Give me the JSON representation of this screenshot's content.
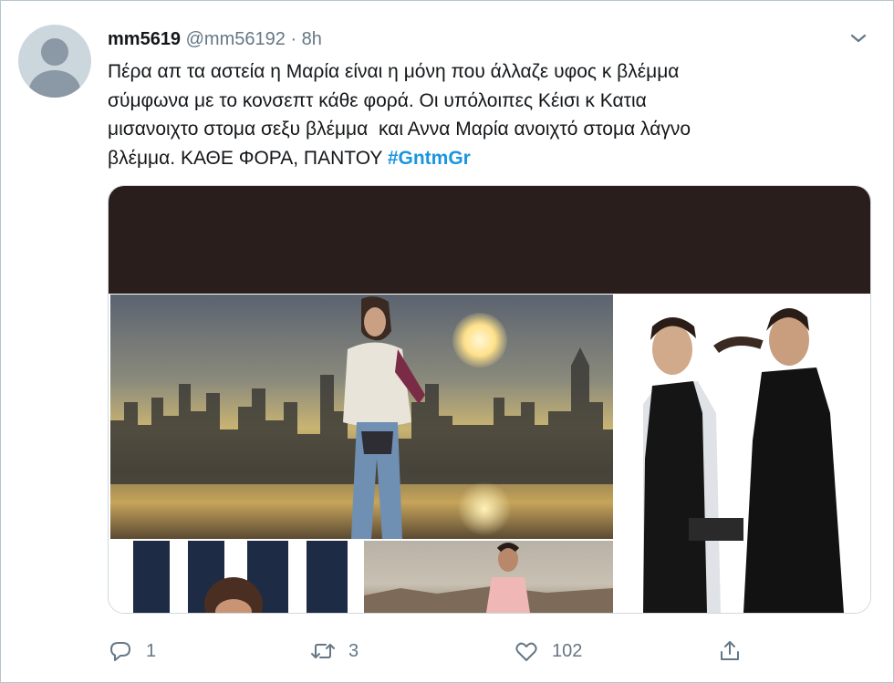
{
  "tweet": {
    "display_name": "mm5619",
    "handle": "@mm56192",
    "separator": "·",
    "time": "8h",
    "text": "Πέρα απ τα αστεία η Μαρία είναι η μόνη που άλλαζε υφος κ βλέμμα\nσύμφωνα με το κονσεπτ κάθε φορά. Οι υπόλοιπες Κέισι κ Κατια\nμισανοιχτο στομα σεξυ βλέμμα  και Αννα Μαρία ανοιχτό στομα λάγνο\nβλέμμα. ΚΑΘΕ ΦΟΡΑ, ΠΑΝΤΟΥ ",
    "hashtag": "#GntmGr"
  },
  "actions": {
    "reply_count": "1",
    "retweet_count": "3",
    "like_count": "102"
  },
  "icons": {
    "avatar": "default-avatar-icon",
    "menu": "chevron-down-icon",
    "reply": "reply-icon",
    "retweet": "retweet-icon",
    "like": "heart-icon",
    "share": "share-icon"
  },
  "colors": {
    "hashtag": "#1b95e0",
    "muted": "#657786",
    "text": "#14171a"
  }
}
